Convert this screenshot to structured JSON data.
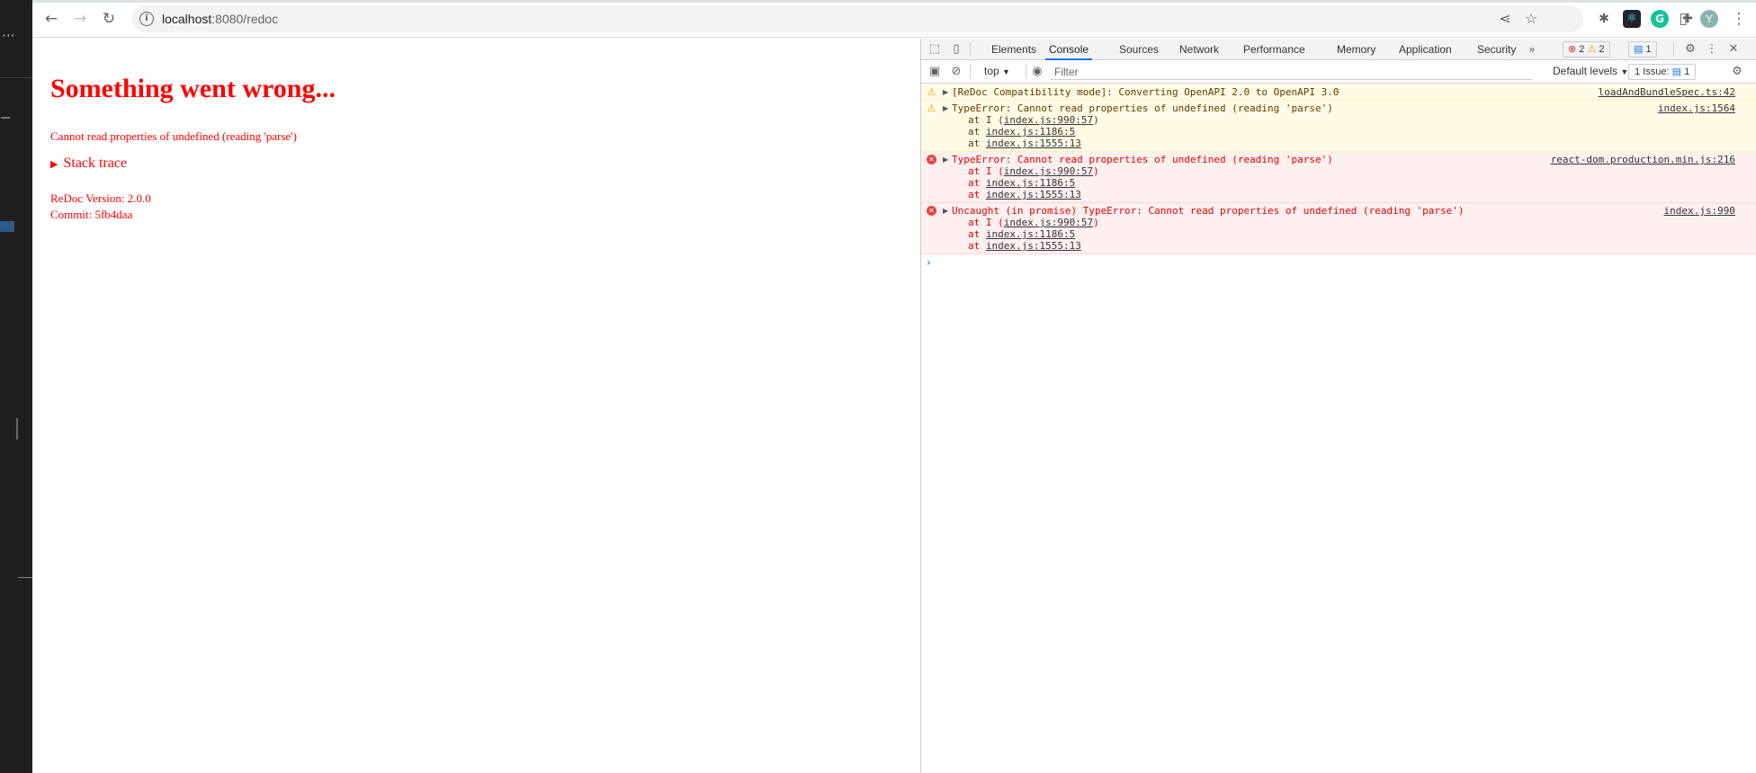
{
  "browser": {
    "url_host": "localhost",
    "url_path": ":8080/redoc"
  },
  "page": {
    "title": "Something went wrong...",
    "message": "Cannot read properties of undefined (reading 'parse')",
    "stack_trace_label": "Stack trace",
    "version": "ReDoc Version: 2.0.0",
    "commit": "Commit: 5fb4daa"
  },
  "devtools": {
    "tabs": [
      "Elements",
      "Console",
      "Sources",
      "Network",
      "Performance",
      "Memory",
      "Application",
      "Security"
    ],
    "active_tab": "Console",
    "error_count": "2",
    "warning_count": "2",
    "info_count": "1",
    "context": "top",
    "filter_placeholder": "Filter",
    "levels": "Default levels",
    "issues_label": "1 Issue:",
    "issues_count": "1",
    "messages": [
      {
        "level": "warning",
        "text": "[ReDoc Compatibility mode]: Converting OpenAPI 2.0 to OpenAPI 3.0",
        "source": "loadAndBundleSpec.ts:42",
        "stack": []
      },
      {
        "level": "warning",
        "text": "TypeError: Cannot read properties of undefined (reading 'parse')",
        "source": "index.js:1564",
        "stack": [
          {
            "prefix": "at I (",
            "link": "index.js:990:57",
            "suffix": ")"
          },
          {
            "prefix": "at ",
            "link": "index.js:1186:5",
            "suffix": ""
          },
          {
            "prefix": "at ",
            "link": "index.js:1555:13",
            "suffix": ""
          }
        ]
      },
      {
        "level": "error",
        "text": "TypeError: Cannot read properties of undefined (reading 'parse')",
        "source": "react-dom.production.min.js:216",
        "stack": [
          {
            "prefix": "at I (",
            "link": "index.js:990:57",
            "suffix": ")"
          },
          {
            "prefix": "at ",
            "link": "index.js:1186:5",
            "suffix": ""
          },
          {
            "prefix": "at ",
            "link": "index.js:1555:13",
            "suffix": ""
          }
        ]
      },
      {
        "level": "error",
        "text": "Uncaught (in promise) TypeError: Cannot read properties of undefined (reading 'parse')",
        "source": "index.js:990",
        "stack": [
          {
            "prefix": "at I (",
            "link": "index.js:990:57",
            "suffix": ")"
          },
          {
            "prefix": "at ",
            "link": "index.js:1186:5",
            "suffix": ""
          },
          {
            "prefix": "at ",
            "link": "index.js:1555:13",
            "suffix": ""
          }
        ]
      }
    ]
  },
  "colors": {
    "error_text": "#ff0000",
    "accent": "#1a73e8"
  }
}
